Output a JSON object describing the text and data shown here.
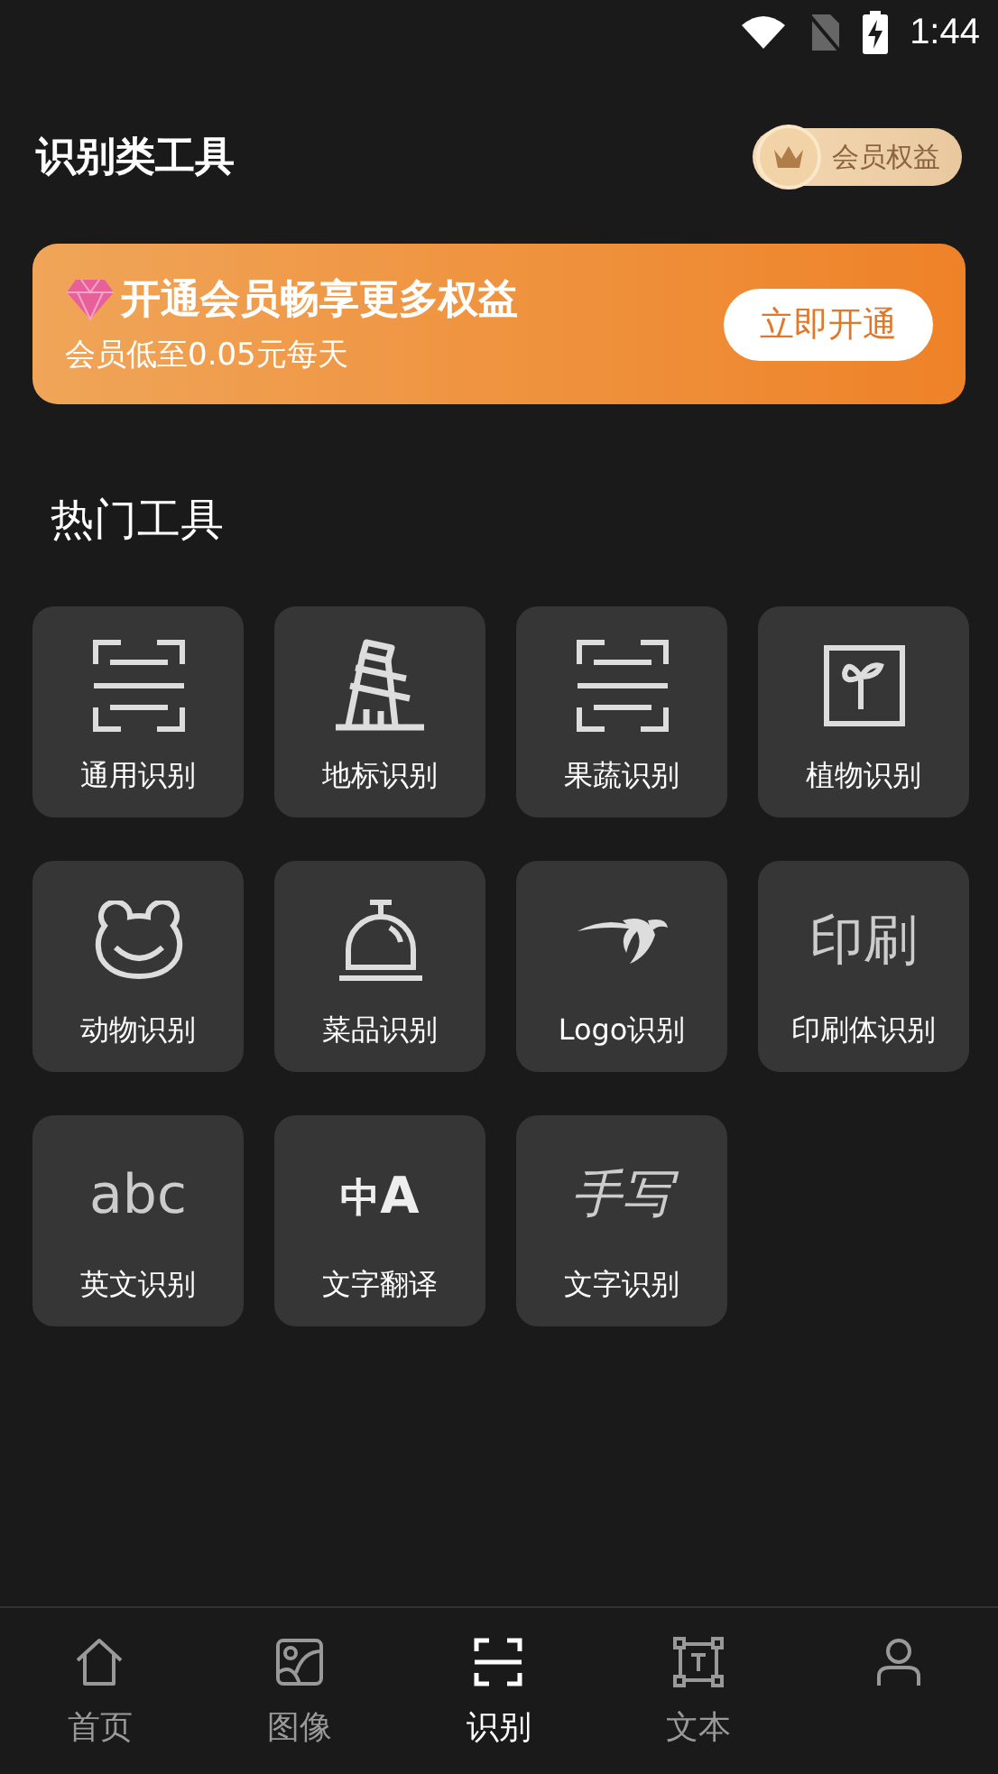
{
  "status_bar": {
    "time": "1:44"
  },
  "header": {
    "title": "识别类工具",
    "member_button": "会员权益"
  },
  "banner": {
    "title": "开通会员畅享更多权益",
    "subtitle": "会员低至0.05元每天",
    "button": "立即开通"
  },
  "section_title": "热门工具",
  "tools": [
    {
      "label": "通用识别",
      "kind": "scan"
    },
    {
      "label": "地标识别",
      "kind": "tower"
    },
    {
      "label": "果蔬识别",
      "kind": "scan"
    },
    {
      "label": "植物识别",
      "kind": "plant"
    },
    {
      "label": "动物识别",
      "kind": "frog"
    },
    {
      "label": "菜品识别",
      "kind": "cloche"
    },
    {
      "label": "Logo识别",
      "kind": "swoosh"
    },
    {
      "label": "印刷体识别",
      "kind": "glyph",
      "glyph": "印刷"
    },
    {
      "label": "英文识别",
      "kind": "glyph",
      "glyph": "abc"
    },
    {
      "label": "文字翻译",
      "kind": "translate",
      "glyph": "中",
      "glyph_2": "A"
    },
    {
      "label": "文字识别",
      "kind": "script",
      "glyph": "手写"
    }
  ],
  "tabs": [
    {
      "label": "首页",
      "kind": "home",
      "selected": false
    },
    {
      "label": "图像",
      "kind": "image",
      "selected": false
    },
    {
      "label": "识别",
      "kind": "scan",
      "selected": true
    },
    {
      "label": "文本",
      "kind": "text",
      "selected": false
    },
    {
      "kind": "person",
      "selected": false
    }
  ]
}
